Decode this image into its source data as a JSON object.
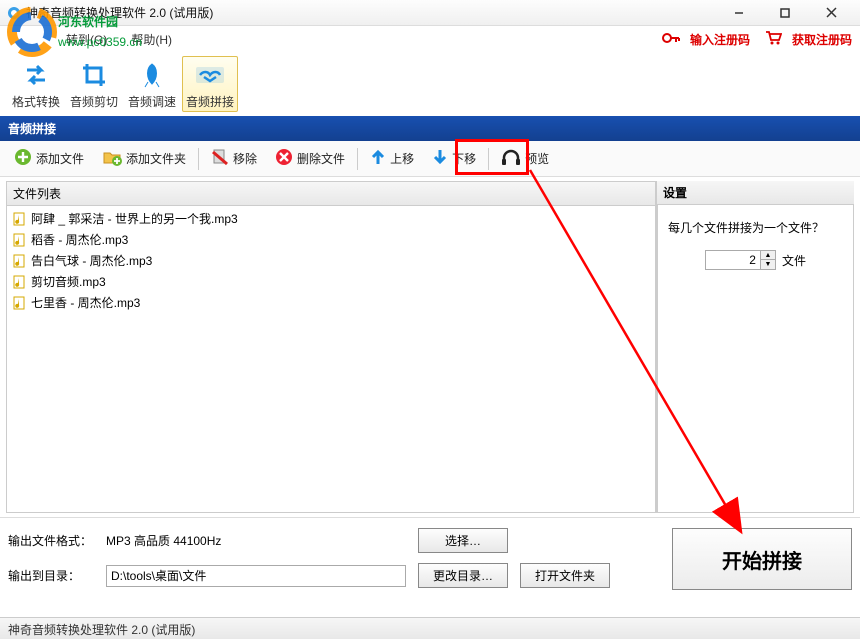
{
  "window": {
    "title": "神奇音频转换处理软件 2.0 (试用版)"
  },
  "menu": {
    "goto": "转到(G)",
    "help": "帮助(H)"
  },
  "watermark": {
    "line1": "河东软件园",
    "line2": "www.pc0359.cn"
  },
  "top_links": {
    "enter_code": "输入注册码",
    "get_code": "获取注册码"
  },
  "big_tabs": {
    "format": "格式转换",
    "cut": "音频剪切",
    "speed": "音频调速",
    "concat": "音频拼接"
  },
  "section_title": "音频拼接",
  "sub_toolbar": {
    "add_file": "添加文件",
    "add_folder": "添加文件夹",
    "remove": "移除",
    "delete": "删除文件",
    "move_up": "上移",
    "move_down": "下移",
    "preview": "预览"
  },
  "file_panel": {
    "header": "文件列表",
    "items": [
      "阿肆 _ 郭采洁 - 世界上的另一个我.mp3",
      "稻香 - 周杰伦.mp3",
      "告白气球 - 周杰伦.mp3",
      "剪切音频.mp3",
      "七里香 - 周杰伦.mp3"
    ]
  },
  "settings": {
    "header": "设置",
    "question": "每几个文件拼接为一个文件？",
    "count": "2",
    "unit": "文件"
  },
  "output": {
    "format_label": "输出文件格式：",
    "format_value": "MP3 高品质 44100Hz",
    "select_btn": "选择…",
    "dir_label": "输出到目录：",
    "dir_value": "D:\\tools\\桌面\\文件",
    "change_dir_btn": "更改目录…",
    "open_folder_btn": "打开文件夹"
  },
  "start_btn": "开始拼接",
  "statusbar": "神奇音频转换处理软件 2.0 (试用版)"
}
